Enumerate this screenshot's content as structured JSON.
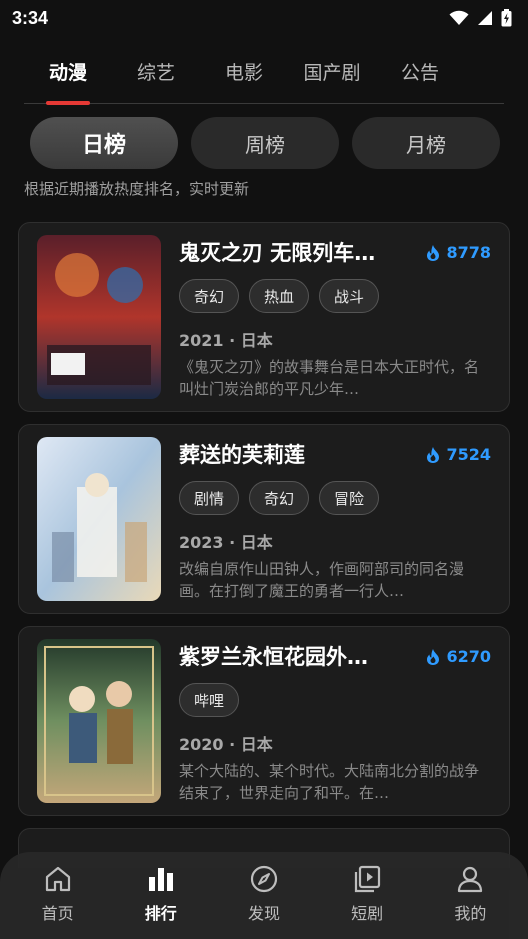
{
  "status_bar": {
    "time": "3:34"
  },
  "top_tabs": [
    {
      "label": "动漫",
      "active": true
    },
    {
      "label": "综艺",
      "active": false
    },
    {
      "label": "电影",
      "active": false
    },
    {
      "label": "国产剧",
      "active": false
    },
    {
      "label": "公告",
      "active": false
    }
  ],
  "periods": [
    {
      "label": "日榜",
      "active": true
    },
    {
      "label": "周榜",
      "active": false
    },
    {
      "label": "月榜",
      "active": false
    }
  ],
  "hint": "根据近期播放热度排名，实时更新",
  "items": [
    {
      "title": "鬼灭之刃 无限列车…",
      "heat": "8778",
      "tags": [
        "奇幻",
        "热血",
        "战斗"
      ],
      "meta": "2021 · 日本",
      "desc": "《鬼灭之刃》的故事舞台是日本大正时代，名叫灶门炭治郎的平凡少年…",
      "poster_colors": [
        "#3a1a22",
        "#b0352b",
        "#1b2a44"
      ]
    },
    {
      "title": "葬送的芙莉莲",
      "heat": "7524",
      "tags": [
        "剧情",
        "奇幻",
        "冒险"
      ],
      "meta": "2023 · 日本",
      "desc": "改编自原作山田钟人，作画阿部司的同名漫画。在打倒了魔王的勇者一行人…",
      "poster_colors": [
        "#c9d6e8",
        "#9fbad6",
        "#e9d9b8"
      ]
    },
    {
      "title": "紫罗兰永恒花园外…",
      "heat": "6270",
      "tags": [
        "哔哩"
      ],
      "meta": "2020 · 日本",
      "desc": "某个大陆的、某个时代。大陆南北分割的战争结束了，世界走向了和平。在…",
      "poster_colors": [
        "#2e4a36",
        "#7a9a6a",
        "#c4a77a"
      ]
    }
  ],
  "bottom_nav": [
    {
      "label": "首页",
      "icon": "home-icon",
      "active": false
    },
    {
      "label": "排行",
      "icon": "ranking-icon",
      "active": true
    },
    {
      "label": "发现",
      "icon": "compass-icon",
      "active": false
    },
    {
      "label": "短剧",
      "icon": "short-video-icon",
      "active": false
    },
    {
      "label": "我的",
      "icon": "profile-icon",
      "active": false
    }
  ],
  "colors": {
    "accent_tab": "#e53935",
    "heat": "#2f9bff",
    "background": "#111111"
  }
}
